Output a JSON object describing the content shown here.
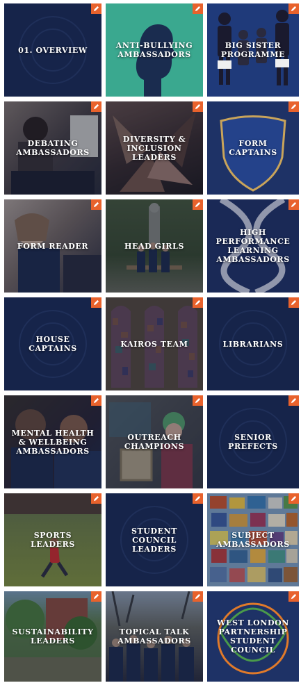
{
  "colors": {
    "navy": "#17264d",
    "teal": "#3aa88f",
    "edit_badge": "#e8622c"
  },
  "edit_icon": "pencil-icon",
  "tiles": [
    {
      "label": "01. Overview"
    },
    {
      "label": "Anti-Bullying Ambassadors"
    },
    {
      "label": "Big Sister Programme"
    },
    {
      "label": "Debating Ambassadors"
    },
    {
      "label": "Diversity & Inclusion Leaders"
    },
    {
      "label": "Form Captains"
    },
    {
      "label": "Form Reader"
    },
    {
      "label": "Head Girls"
    },
    {
      "label": "High Performance Learning Ambassadors"
    },
    {
      "label": "House Captains"
    },
    {
      "label": "Kairos Team"
    },
    {
      "label": "Librarians"
    },
    {
      "label": "Mental Health & Wellbeing Ambassadors"
    },
    {
      "label": "Outreach Champions"
    },
    {
      "label": "Senior Prefects"
    },
    {
      "label": "Sports Leaders"
    },
    {
      "label": "Student Council Leaders"
    },
    {
      "label": "Subject Ambassadors"
    },
    {
      "label": "Sustainability Leaders"
    },
    {
      "label": "Topical Talk Ambassadors"
    },
    {
      "label": "West London Partnership Student Council"
    }
  ]
}
